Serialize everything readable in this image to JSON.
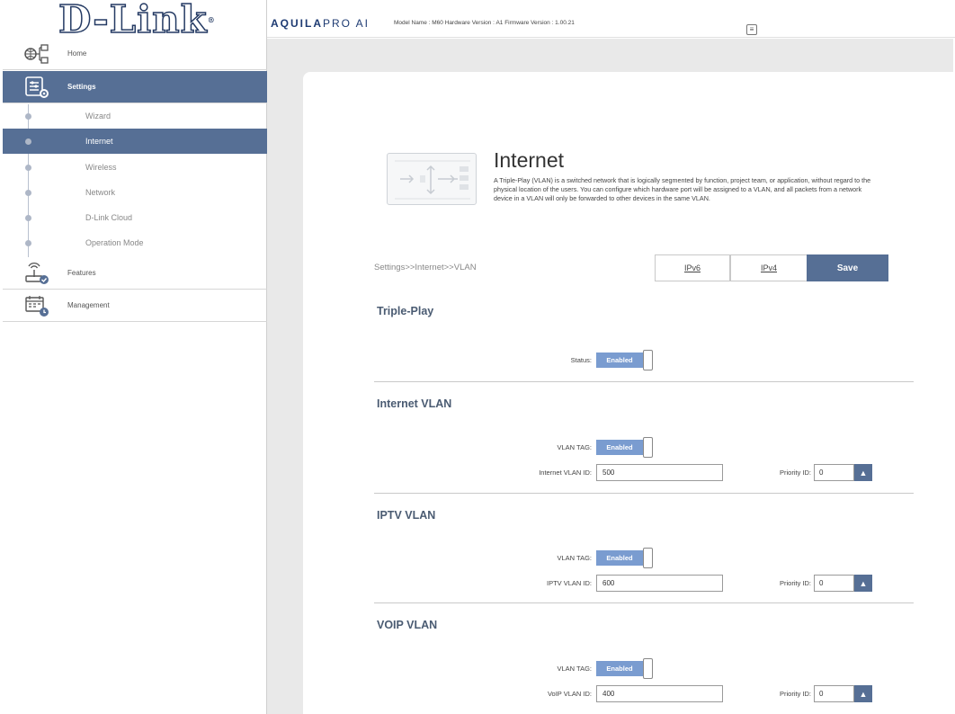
{
  "app": {
    "logo_text": "D-Link",
    "logo_mark": "®",
    "brand_aquila": "AQUILA",
    "brand_pro": "PRO AI",
    "model_info": "Model Name : M60 Hardware Version : A1 Firmware Version : 1.00.21",
    "menu_icon": "document-icon"
  },
  "sidebar": {
    "home": {
      "label": "Home",
      "icon": "network-home-icon"
    },
    "settings": {
      "label": "Settings",
      "icon": "settings-gear-icon"
    },
    "settings_items": [
      {
        "label": "Wizard"
      },
      {
        "label": "Internet"
      },
      {
        "label": "Wireless"
      },
      {
        "label": "Network"
      },
      {
        "label": "D-Link Cloud"
      },
      {
        "label": "Operation Mode"
      }
    ],
    "features": {
      "label": "Features",
      "icon": "router-check-icon"
    },
    "management": {
      "label": "Management",
      "icon": "calendar-clock-icon"
    }
  },
  "page": {
    "title": "Internet",
    "description": "A Triple-Play (VLAN) is a switched network that is logically segmented by function, project team, or application, without regard to the physical location of the users. You can configure which hardware port will be assigned to a VLAN, and all packets from a network device in a VLAN will only be forwarded to other devices in the same VLAN.",
    "breadcrumb": "Settings>>Internet>>VLAN",
    "buttons": {
      "ipv6": "IPv6",
      "ipv4": "IPv4",
      "save": "Save"
    }
  },
  "triple_play": {
    "title": "Triple-Play",
    "status_label": "Status:",
    "status_value": "Enabled"
  },
  "internet_vlan": {
    "title": "Internet VLAN",
    "tag_label": "VLAN TAG:",
    "tag_value": "Enabled",
    "id_label": "Internet VLAN ID:",
    "id_value": "500",
    "priority_label": "Priority ID:",
    "priority_value": "0"
  },
  "iptv_vlan": {
    "title": "IPTV VLAN",
    "tag_label": "VLAN TAG:",
    "tag_value": "Enabled",
    "id_label": "IPTV VLAN ID:",
    "id_value": "600",
    "priority_label": "Priority ID:",
    "priority_value": "0"
  },
  "voip_vlan": {
    "title": "VOIP VLAN",
    "tag_label": "VLAN TAG:",
    "tag_value": "Enabled",
    "id_label": "VoIP VLAN ID:",
    "id_value": "400",
    "priority_label": "Priority ID:",
    "priority_value": "0"
  },
  "colors": {
    "accent": "#566f95",
    "toggle_on": "#7a9cd0",
    "section_title": "#4a5b72",
    "brand": "#1d3a72"
  }
}
